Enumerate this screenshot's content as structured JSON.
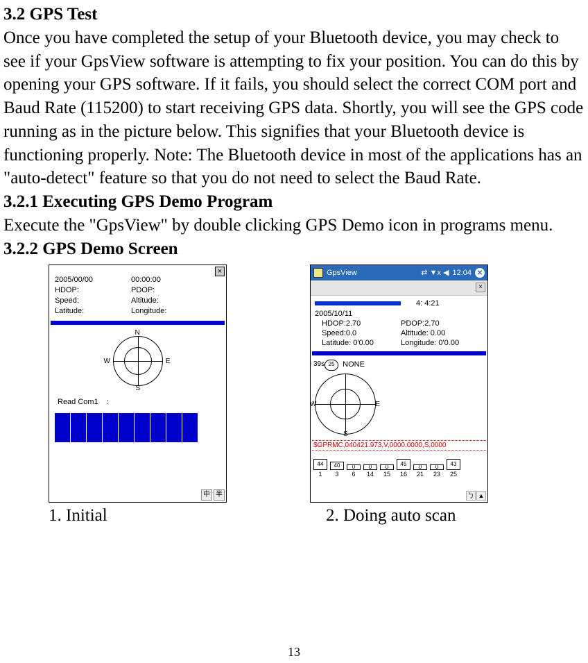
{
  "section_heading": "3.2 GPS Test",
  "paragraph": "Once you have completed the setup of your Bluetooth device, you may check to see if your GpsView software is attempting to fix your position. You can do this by opening your GPS software. If it fails, you should select the correct COM port and Baud Rate (115200) to start receiving GPS data. Shortly, you will see the GPS code running as in the picture below. This signifies that your Bluetooth device is functioning properly. Note: The Bluetooth device in most of the applications has an \"auto-detect\" feature so that you do not need to select the Baud Rate.",
  "sub1": "3.2.1 Executing GPS Demo Program",
  "sub1_text": "Execute the \"GpsView\" by double clicking GPS Demo icon in programs menu.",
  "sub2": "3.2.2 GPS Demo Screen",
  "screenshot1": {
    "close": "×",
    "date": "2005/00/00",
    "time": "00:00:00",
    "hdop_label": "HDOP:",
    "pdop_label": "PDOP:",
    "speed_label": "Speed:",
    "alt_label": "Altitude:",
    "lat_label": "Latitude:",
    "lon_label": "Longitude:",
    "compass_n": "N",
    "compass_s": "S",
    "compass_e": "E",
    "compass_w": "W",
    "status": "Read Com1",
    "colon": ":",
    "ime1": "中",
    "ime2": "半"
  },
  "screenshot2": {
    "app_title": "GpsView",
    "clock_icons": "⇄ ▼x ◀",
    "clock_time": "12:04",
    "close_circle": "✕",
    "x": "×",
    "date": "2005/10/11",
    "time": "4: 4:21",
    "hdop": "HDOP:2.70",
    "pdop": "PDOP:2.70",
    "speed": "Speed:0.0",
    "alt": "Altitude:  0.00",
    "lat": "Latitude: 0'0.00",
    "lon": "Longitude: 0'0.00",
    "sat_left": "39s",
    "sat_circle": "25",
    "none": "NONE",
    "compass_w": "W",
    "compass_e": "E",
    "compass_s": "S",
    "nmea": "$GPRMC,040421.973,V,0000.0000,S,0000",
    "signals": [
      {
        "val": "44",
        "h": 16,
        "id": "1"
      },
      {
        "val": "40",
        "h": 12,
        "id": "3"
      },
      {
        "val": "0",
        "h": 8,
        "id": "6"
      },
      {
        "val": "0",
        "h": 8,
        "id": "14"
      },
      {
        "val": "0",
        "h": 8,
        "id": "15"
      },
      {
        "val": "45",
        "h": 16,
        "id": "16"
      },
      {
        "val": "0",
        "h": 8,
        "id": "21"
      },
      {
        "val": "0",
        "h": 8,
        "id": "23"
      },
      {
        "val": "43",
        "h": 16,
        "id": "25"
      }
    ],
    "ime1": "ㄅ",
    "ime2": "▲"
  },
  "caption1": "1. Initial",
  "caption2": "2. Doing auto scan",
  "page_number": "13"
}
